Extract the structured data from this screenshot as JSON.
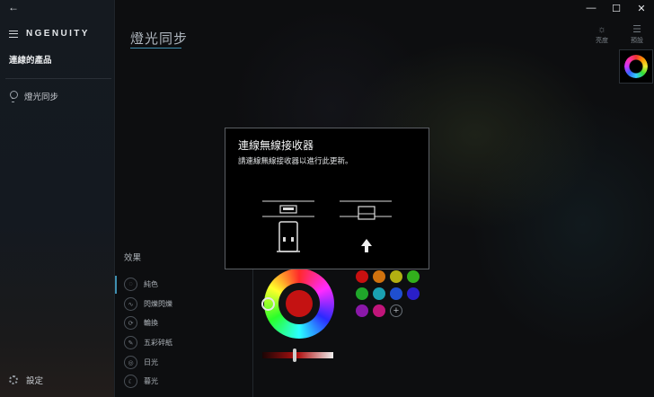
{
  "titlebar": {
    "back_icon": "arrow-left-icon",
    "minimize_glyph": "—",
    "maximize_glyph": "☐",
    "close_glyph": "✕"
  },
  "sidebar": {
    "brand": "NGENUITY",
    "products_label": "連線的產品",
    "nav": [
      {
        "label": "燈光同步",
        "icon": "bulb-icon"
      }
    ],
    "settings_label": "設定"
  },
  "main": {
    "title": "燈光同步",
    "tools": [
      {
        "label": "亮度",
        "icon": "brightness-icon",
        "glyph": "☼"
      },
      {
        "label": "預設",
        "icon": "sliders-icon",
        "glyph": "☰"
      }
    ],
    "effects_title": "效果",
    "effects": [
      {
        "label": "純色",
        "icon": "solid-icon",
        "glyph": "◌"
      },
      {
        "label": "閃爍閃爍",
        "icon": "wave-icon",
        "glyph": "∿"
      },
      {
        "label": "輪換",
        "icon": "cycle-icon",
        "glyph": "⟳"
      },
      {
        "label": "五彩碎紙",
        "icon": "confetti-icon",
        "glyph": "✎"
      },
      {
        "label": "日光",
        "icon": "sun-icon",
        "glyph": "◎"
      },
      {
        "label": "暮光",
        "icon": "moon-icon",
        "glyph": "☾"
      }
    ],
    "selected_color": "#c41212",
    "brightness_value": 0.45,
    "swatches": [
      "#c81010",
      "#d0720e",
      "#b3b012",
      "#32b01c",
      "#1fa62a",
      "#1a9fb0",
      "#1f4fd0",
      "#2a1fc8",
      "#8a18a8",
      "#c0157a"
    ],
    "add_swatch_glyph": "+"
  },
  "modal": {
    "title": "連線無線接收器",
    "message": "請連線無線接收器以進行此更新。"
  },
  "colors": {
    "accent": "#3f8fb0",
    "modal_bg": "#000000",
    "sidebar_bg": "#151a20"
  }
}
